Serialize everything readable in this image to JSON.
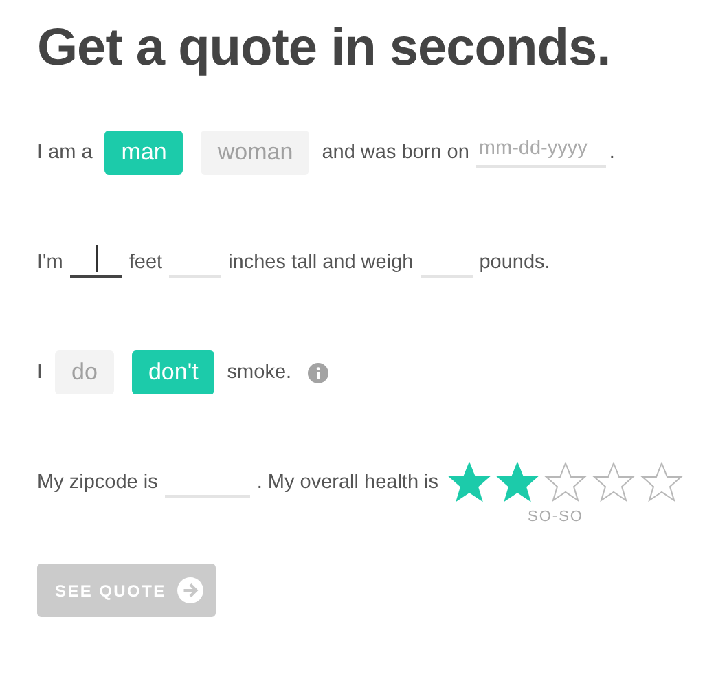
{
  "title": "Get a quote in seconds.",
  "rows": [
    {
      "parts": [
        {
          "kind": "text",
          "text": "I am a"
        },
        {
          "kind": "toggle",
          "label": "man",
          "selected": true
        },
        {
          "kind": "toggle",
          "label": "woman",
          "selected": false
        },
        {
          "kind": "text",
          "text": "and was born on"
        },
        {
          "kind": "date",
          "placeholder": "mm-dd-yyyy",
          "focused": false
        },
        {
          "kind": "text",
          "text": "."
        }
      ]
    },
    {
      "parts": [
        {
          "kind": "text",
          "text": "I'm"
        },
        {
          "kind": "field",
          "focused": true
        },
        {
          "kind": "text",
          "text": "feet"
        },
        {
          "kind": "field",
          "focused": false
        },
        {
          "kind": "text",
          "text": "inches tall and weigh"
        },
        {
          "kind": "field",
          "focused": false
        },
        {
          "kind": "text",
          "text": "pounds."
        }
      ]
    },
    {
      "parts": [
        {
          "kind": "text",
          "text": "I"
        },
        {
          "kind": "toggle",
          "label": "do",
          "selected": false
        },
        {
          "kind": "toggle",
          "label": "don't",
          "selected": true
        },
        {
          "kind": "text",
          "text": "smoke."
        },
        {
          "kind": "info"
        }
      ]
    },
    {
      "parts": [
        {
          "kind": "text",
          "text": "My zipcode is"
        },
        {
          "kind": "zip",
          "focused": false
        },
        {
          "kind": "text",
          "text": ". My overall health is"
        },
        {
          "kind": "rating",
          "stars": 2,
          "caption": "SO-SO"
        }
      ]
    }
  ],
  "submit": {
    "label": "SEE QUOTE",
    "disabled": true
  }
}
